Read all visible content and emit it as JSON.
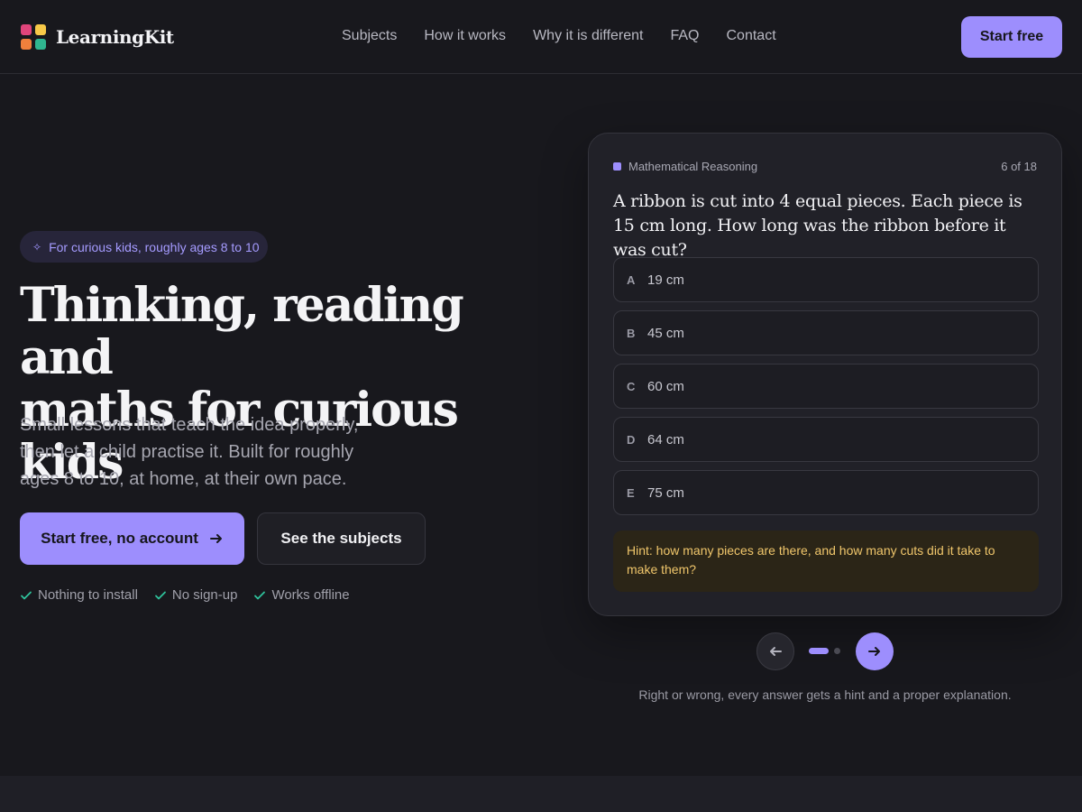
{
  "brand": {
    "name": "LearningKit",
    "logo_colors": [
      "#e0457b",
      "#f7c948",
      "#f0803c",
      "#2fb58f"
    ]
  },
  "nav": {
    "items": [
      "Subjects",
      "How it works",
      "Why it is different",
      "FAQ",
      "Contact"
    ],
    "cta": "Start free"
  },
  "hero": {
    "badge": "For curious kids, roughly ages 8 to 10",
    "title_line1": "Thinking, reading and",
    "title_line2": "maths for curious kids",
    "subtitle_line1": "Small lessons that teach the idea properly,",
    "subtitle_line2": "then let a child practise it. Built for roughly",
    "subtitle_line3": "ages 8 to 10, at home, at their own pace.",
    "primary_cta": "Start free, no account",
    "secondary_cta": "See the subjects",
    "checks": [
      "Nothing to install",
      "No sign-up",
      "Works offline"
    ]
  },
  "quiz": {
    "category": "Mathematical Reasoning",
    "progress": "6 of 18",
    "question": "A ribbon is cut into 4 equal pieces. Each piece is 15 cm long. How long was the ribbon before it was cut?",
    "options": [
      {
        "letter": "A",
        "text": "19 cm"
      },
      {
        "letter": "B",
        "text": "45 cm"
      },
      {
        "letter": "C",
        "text": "60 cm"
      },
      {
        "letter": "D",
        "text": "64 cm"
      },
      {
        "letter": "E",
        "text": "75 cm"
      }
    ],
    "hint": "Hint: how many pieces are there, and how many cuts did it take to make them?"
  },
  "carousel": {
    "caption": "Right or wrong, every answer gets a hint and a proper explanation.",
    "active_index": 0,
    "total": 2
  },
  "colors": {
    "accent": "#9d8efd",
    "background": "#18181d",
    "check": "#2fc29b",
    "hint_text": "#f0c66b"
  }
}
